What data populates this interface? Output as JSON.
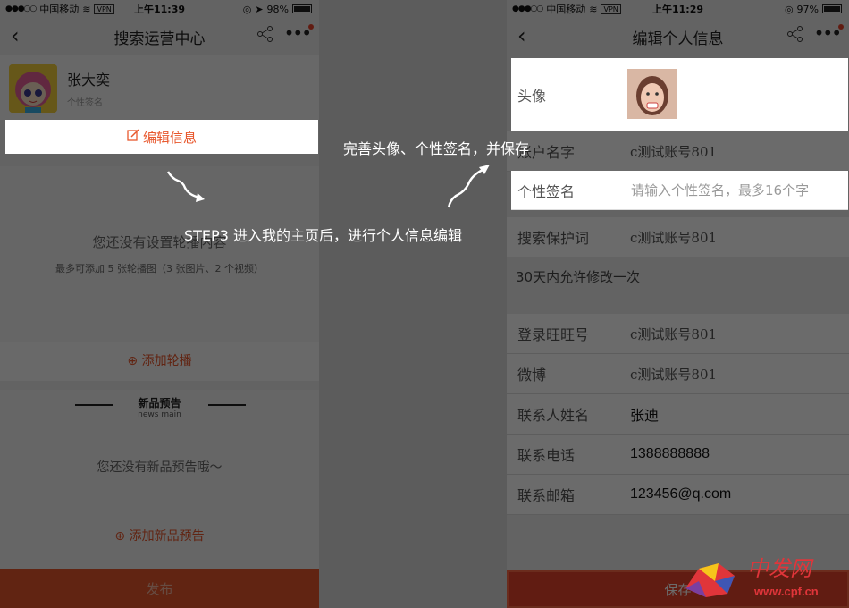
{
  "left": {
    "status": {
      "carrier": "中国移动",
      "vpn": "VPN",
      "time": "上午11:39",
      "battery": "98%"
    },
    "nav_title": "搜索运营中心",
    "profile": {
      "name": "张大奕",
      "signature_placeholder": "个性签名"
    },
    "edit_button": "编辑信息",
    "carousel": {
      "empty_text": "您还没有设置轮播内容",
      "hint": "最多可添加 5 张轮播图（3 张图片、2 个视频）",
      "add_label": "添加轮播"
    },
    "news": {
      "title": "新品预告",
      "subtitle": "news main",
      "empty_text": "您还没有新品预告哦～",
      "add_label": "添加新品预告"
    },
    "publish_button": "发布"
  },
  "right": {
    "status": {
      "carrier": "中国移动",
      "vpn": "VPN",
      "time": "上午11:29",
      "battery": "97%"
    },
    "nav_title": "编辑个人信息",
    "avatar_label": "头像",
    "rows": [
      {
        "label": "账户名字",
        "value": "c测试账号801"
      },
      {
        "label": "个性签名",
        "placeholder": "请输入个性签名，最多16个字"
      },
      {
        "label": "搜索保护词",
        "value": "c测试账号801"
      }
    ],
    "note": "30天内允许修改一次",
    "rows2": [
      {
        "label": "登录旺旺号",
        "value": "c测试账号801"
      },
      {
        "label": "微博",
        "value": "c测试账号801"
      },
      {
        "label": "联系人姓名",
        "value": "张迪"
      },
      {
        "label": "联系电话",
        "value": "1388888888"
      },
      {
        "label": "联系邮箱",
        "value": "123456@q.com"
      }
    ],
    "save_button": "保存"
  },
  "annotations": {
    "step": "STEP3    进入我的主页后，进行个人信息编辑",
    "tip": "完善头像、个性签名，并保存"
  },
  "watermark": {
    "text": "中发网",
    "url": "www.cpf.cn"
  },
  "colors": {
    "accent": "#e8572c",
    "save": "#e8442c"
  }
}
